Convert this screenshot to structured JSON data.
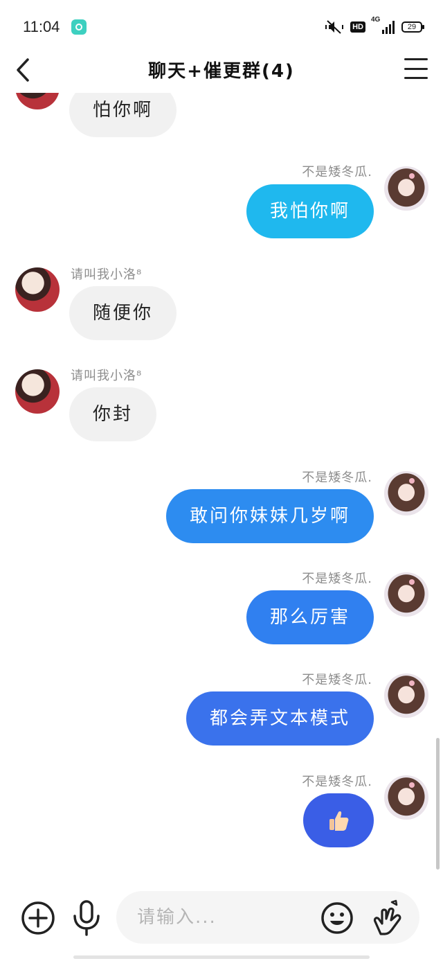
{
  "status_bar": {
    "time": "11:04",
    "network": "4G",
    "hd": "HD",
    "battery": "29"
  },
  "header": {
    "title": "聊天+催更群(4)"
  },
  "messages": [
    {
      "side": "in",
      "sender": "",
      "text": "怕你啊"
    },
    {
      "side": "out",
      "sender": "不是矮冬瓜.",
      "text": "我怕你啊",
      "color": "#1fb8ee"
    },
    {
      "side": "in",
      "sender": "请叫我小洛⁸",
      "text": "随便你"
    },
    {
      "side": "in",
      "sender": "请叫我小洛⁸",
      "text": "你封"
    },
    {
      "side": "out",
      "sender": "不是矮冬瓜.",
      "text": "敢问你妹妹几岁啊",
      "color": "#2d8cf0"
    },
    {
      "side": "out",
      "sender": "不是矮冬瓜.",
      "text": "那么厉害",
      "color": "#3080f0"
    },
    {
      "side": "out",
      "sender": "不是矮冬瓜.",
      "text": "都会弄文本模式",
      "color": "#3a72ec"
    },
    {
      "side": "out",
      "sender": "不是矮冬瓜.",
      "text": "",
      "emoji": "thumbs-up",
      "color": "#3a5ee6"
    }
  ],
  "input": {
    "placeholder": "请输入..."
  },
  "icons": {
    "back": "chevron-left-icon",
    "menu": "menu-icon",
    "plus": "plus-circle-icon",
    "mic": "microphone-icon",
    "emoji": "smiley-icon",
    "gesture": "finger-heart-icon"
  }
}
